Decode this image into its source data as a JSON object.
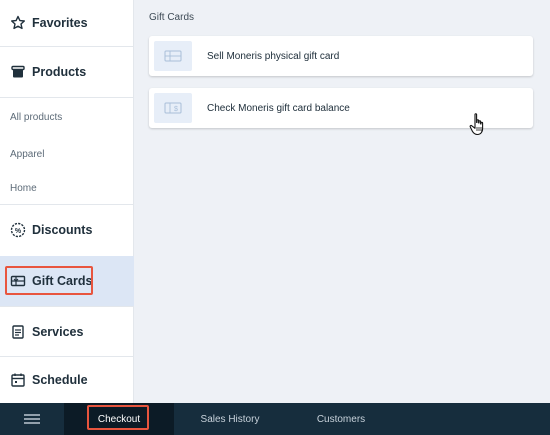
{
  "sidebar": {
    "categories": {
      "favorites": "Favorites",
      "products": "Products",
      "discounts": "Discounts",
      "gift_cards": "Gift Cards",
      "services": "Services",
      "schedule": "Schedule"
    },
    "subitems": [
      "All products",
      "Apparel",
      "Home"
    ]
  },
  "main": {
    "section_title": "Gift Cards",
    "cards": [
      {
        "label": "Sell Moneris physical gift card",
        "icon": "gift-card-icon"
      },
      {
        "label": "Check Moneris gift card balance",
        "icon": "gift-card-balance-icon"
      }
    ]
  },
  "bottom_bar": {
    "tabs": [
      "Checkout",
      "Sales History",
      "Customers"
    ],
    "active_tab": "Checkout"
  },
  "colors": {
    "accent_highlight": "#e8553e",
    "active_sidebar_bg": "#dce6f5",
    "bottom_bar_bg": "#162d3d"
  }
}
